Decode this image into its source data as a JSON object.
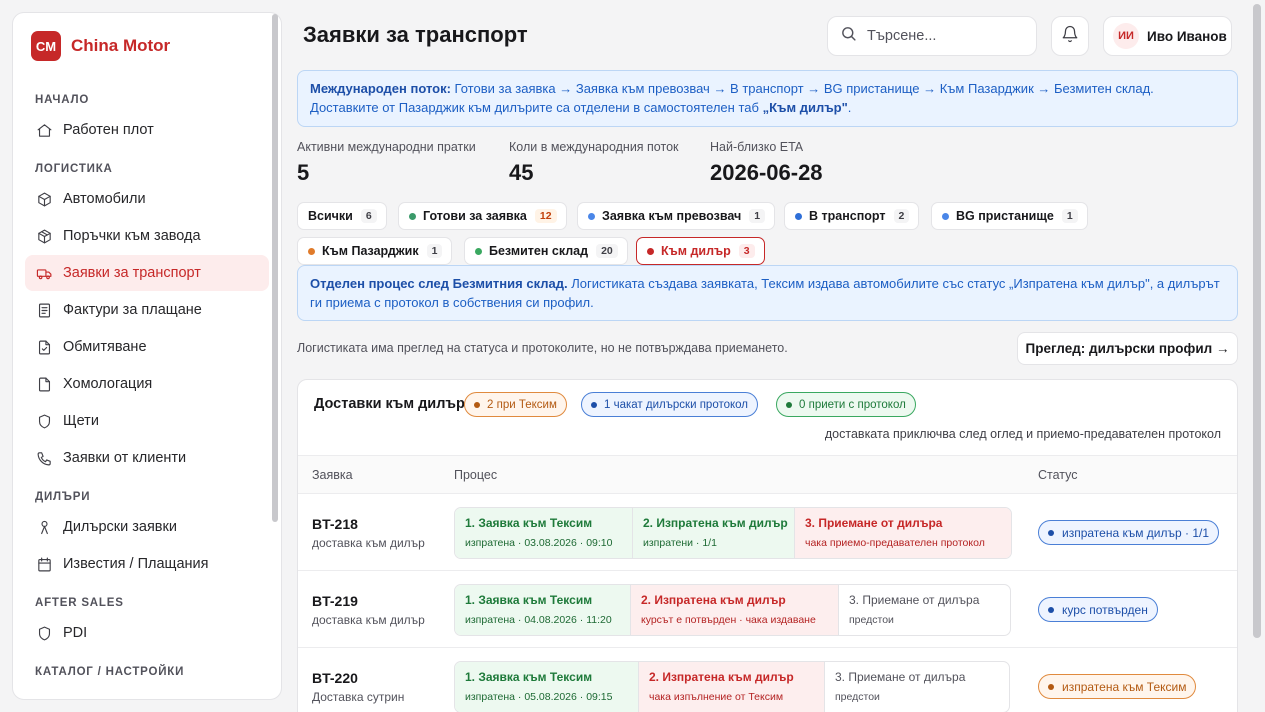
{
  "brand": {
    "logo": "CM",
    "name": "China Motor"
  },
  "sidebar": {
    "sections": [
      {
        "label": "НАЧАЛО",
        "items": [
          {
            "label": "Работен плот",
            "icon": "home-icon"
          }
        ]
      },
      {
        "label": "ЛОГИСТИКА",
        "items": [
          {
            "label": "Автомобили",
            "icon": "box-icon"
          },
          {
            "label": "Поръчки към завода",
            "icon": "package-icon"
          },
          {
            "label": "Заявки за транспорт",
            "icon": "truck-icon",
            "active": true
          },
          {
            "label": "Фактури за плащане",
            "icon": "invoice-icon"
          },
          {
            "label": "Обмитяване",
            "icon": "file-check-icon"
          },
          {
            "label": "Хомологация",
            "icon": "file-icon"
          },
          {
            "label": "Щети",
            "icon": "shield-icon"
          },
          {
            "label": "Заявки от клиенти",
            "icon": "phone-icon"
          }
        ]
      },
      {
        "label": "ДИЛЪРИ",
        "items": [
          {
            "label": "Дилърски заявки",
            "icon": "person-icon"
          },
          {
            "label": "Известия / Плащания",
            "icon": "calendar-icon"
          }
        ]
      },
      {
        "label": "AFTER SALES",
        "items": [
          {
            "label": "PDI",
            "icon": "shield-icon"
          }
        ]
      },
      {
        "label": "КАТАЛОГ / НАСТРОЙКИ",
        "items": []
      }
    ]
  },
  "header": {
    "title": "Заявки за транспорт",
    "search_placeholder": "Търсене...",
    "user_initials": "ИИ",
    "user_name": "Иво Иванов"
  },
  "info1": {
    "bold": "Международен поток:",
    "text": " Готови за заявка → Заявка към превозвач → В транспорт → BG пристанище → Към Пазарджик → Безмитен склад.",
    "line2_text": "Доставките от Пазарджик към дилърите са отделени в самостоятелен таб ",
    "line2_bold": "„Към дилър\"",
    "line2_end": "."
  },
  "stats": [
    {
      "label": "Активни международни пратки",
      "value": "5"
    },
    {
      "label": "Коли в международния поток",
      "value": "45"
    },
    {
      "label": "Най-близко ETA",
      "value": "2026-06-28"
    }
  ],
  "filters": [
    {
      "label": "Всички",
      "count": "6",
      "dot": ""
    },
    {
      "label": "Готови за заявка",
      "count": "12",
      "dot": "#3a9a6a"
    },
    {
      "label": "Заявка към превозвач",
      "count": "1",
      "dot": "#4a86e8"
    },
    {
      "label": "В транспорт",
      "count": "2",
      "dot": "#2e6fd8"
    },
    {
      "label": "BG пристанище",
      "count": "1",
      "dot": "#4a86e8"
    },
    {
      "label": "Към Пазарджик",
      "count": "1",
      "dot": "#e07b2a"
    },
    {
      "label": "Безмитен склад",
      "count": "20",
      "dot": "#3aa860"
    },
    {
      "label": "Към дилър",
      "count": "3",
      "dot": "#c62828",
      "active": true
    }
  ],
  "info2": {
    "bold": "Отделен процес след Безмитния склад.",
    "text": " Логистиката създава заявката, Тексим издава автомобилите със статус „Изпратена към дилър\", а дилърът ги приема с протокол в собствения си профил."
  },
  "note": "Логистиката има преглед на статуса и протоколите, но не потвърждава приемането.",
  "view_button": "Преглед: дилърски профил →",
  "card": {
    "title": "Доставки към дилър",
    "pills": [
      {
        "label": "2 при Тексим",
        "color": "#b35a12",
        "border": "#e08a3e",
        "bg": "#fff5ec"
      },
      {
        "label": "1 чакат дилърски протокол",
        "color": "#1d4fa8",
        "border": "#4a7fd6",
        "bg": "#eef4ff"
      },
      {
        "label": "0 приети с протокол",
        "color": "#1e7a3a",
        "border": "#3aa860",
        "bg": "#edf9f0"
      }
    ],
    "subtitle": "доставката приключва след оглед и приемо-предавателен протокол",
    "columns": {
      "request": "Заявка",
      "process": "Процес",
      "status": "Статус"
    },
    "rows": [
      {
        "id": "BT-218",
        "sub": "доставка към дилър",
        "steps": [
          {
            "title": "1. Заявка към Тексим",
            "detail": "изпратена · 03.08.2026 · 09:10",
            "state": "done"
          },
          {
            "title": "2. Изпратена към дилър",
            "detail": "изпратени · 1/1",
            "state": "done"
          },
          {
            "title": "3. Приемане от дилъра",
            "detail": "чака приемо-предавателен протокол",
            "state": "cur"
          }
        ],
        "status": "изпратена към дилър · 1/1",
        "status_style": "blue"
      },
      {
        "id": "BT-219",
        "sub": "доставка към дилър",
        "steps": [
          {
            "title": "1. Заявка към Тексим",
            "detail": "изпратена · 04.08.2026 · 11:20",
            "state": "done"
          },
          {
            "title": "2. Изпратена към дилър",
            "detail": "курсът е потвърден · чака издаване",
            "state": "cur"
          },
          {
            "title": "3. Приемане от дилъра",
            "detail": "предстои",
            "state": "pend"
          }
        ],
        "status": "курс потвърден",
        "status_style": "blue"
      },
      {
        "id": "BT-220",
        "sub": "Доставка сутрин",
        "steps": [
          {
            "title": "1. Заявка към Тексим",
            "detail": "изпратена · 05.08.2026 · 09:15",
            "state": "done"
          },
          {
            "title": "2. Изпратена към дилър",
            "detail": "чака изпълнение от Тексим",
            "state": "cur"
          },
          {
            "title": "3. Приемане от дилъра",
            "detail": "предстои",
            "state": "pend"
          }
        ],
        "status": "изпратена към Тексим",
        "status_style": "orange"
      }
    ]
  }
}
